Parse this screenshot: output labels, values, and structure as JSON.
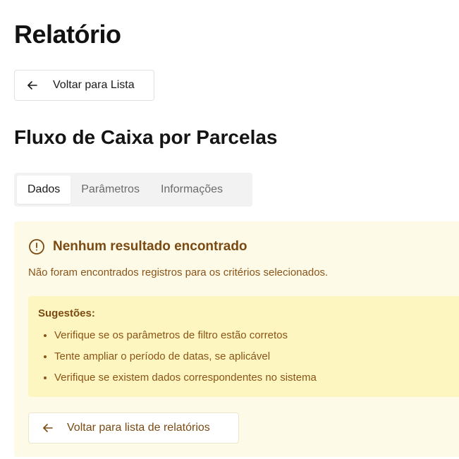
{
  "page": {
    "title": "Relatório",
    "back_button_label": "Voltar para Lista",
    "report_title": "Fluxo de Caixa por Parcelas"
  },
  "tabs": [
    {
      "label": "Dados",
      "active": true
    },
    {
      "label": "Parâmetros",
      "active": false
    },
    {
      "label": "Informações",
      "active": false
    }
  ],
  "alert": {
    "icon": "info-circle-icon",
    "title": "Nenhum resultado encontrado",
    "description": "Não foram encontrados registros para os critérios selecionados.",
    "suggestions": {
      "title": "Sugestões:",
      "items": [
        "Verifique se os parâmetros de filtro estão corretos",
        "Tente ampliar o período de datas, se aplicável",
        "Verifique se existem dados correspondentes no sistema"
      ]
    },
    "back_button_label": "Voltar para lista de relatórios"
  },
  "colors": {
    "alert_background": "#fefae8",
    "suggestions_background": "#fef6c0",
    "alert_text": "#7a4a12"
  }
}
